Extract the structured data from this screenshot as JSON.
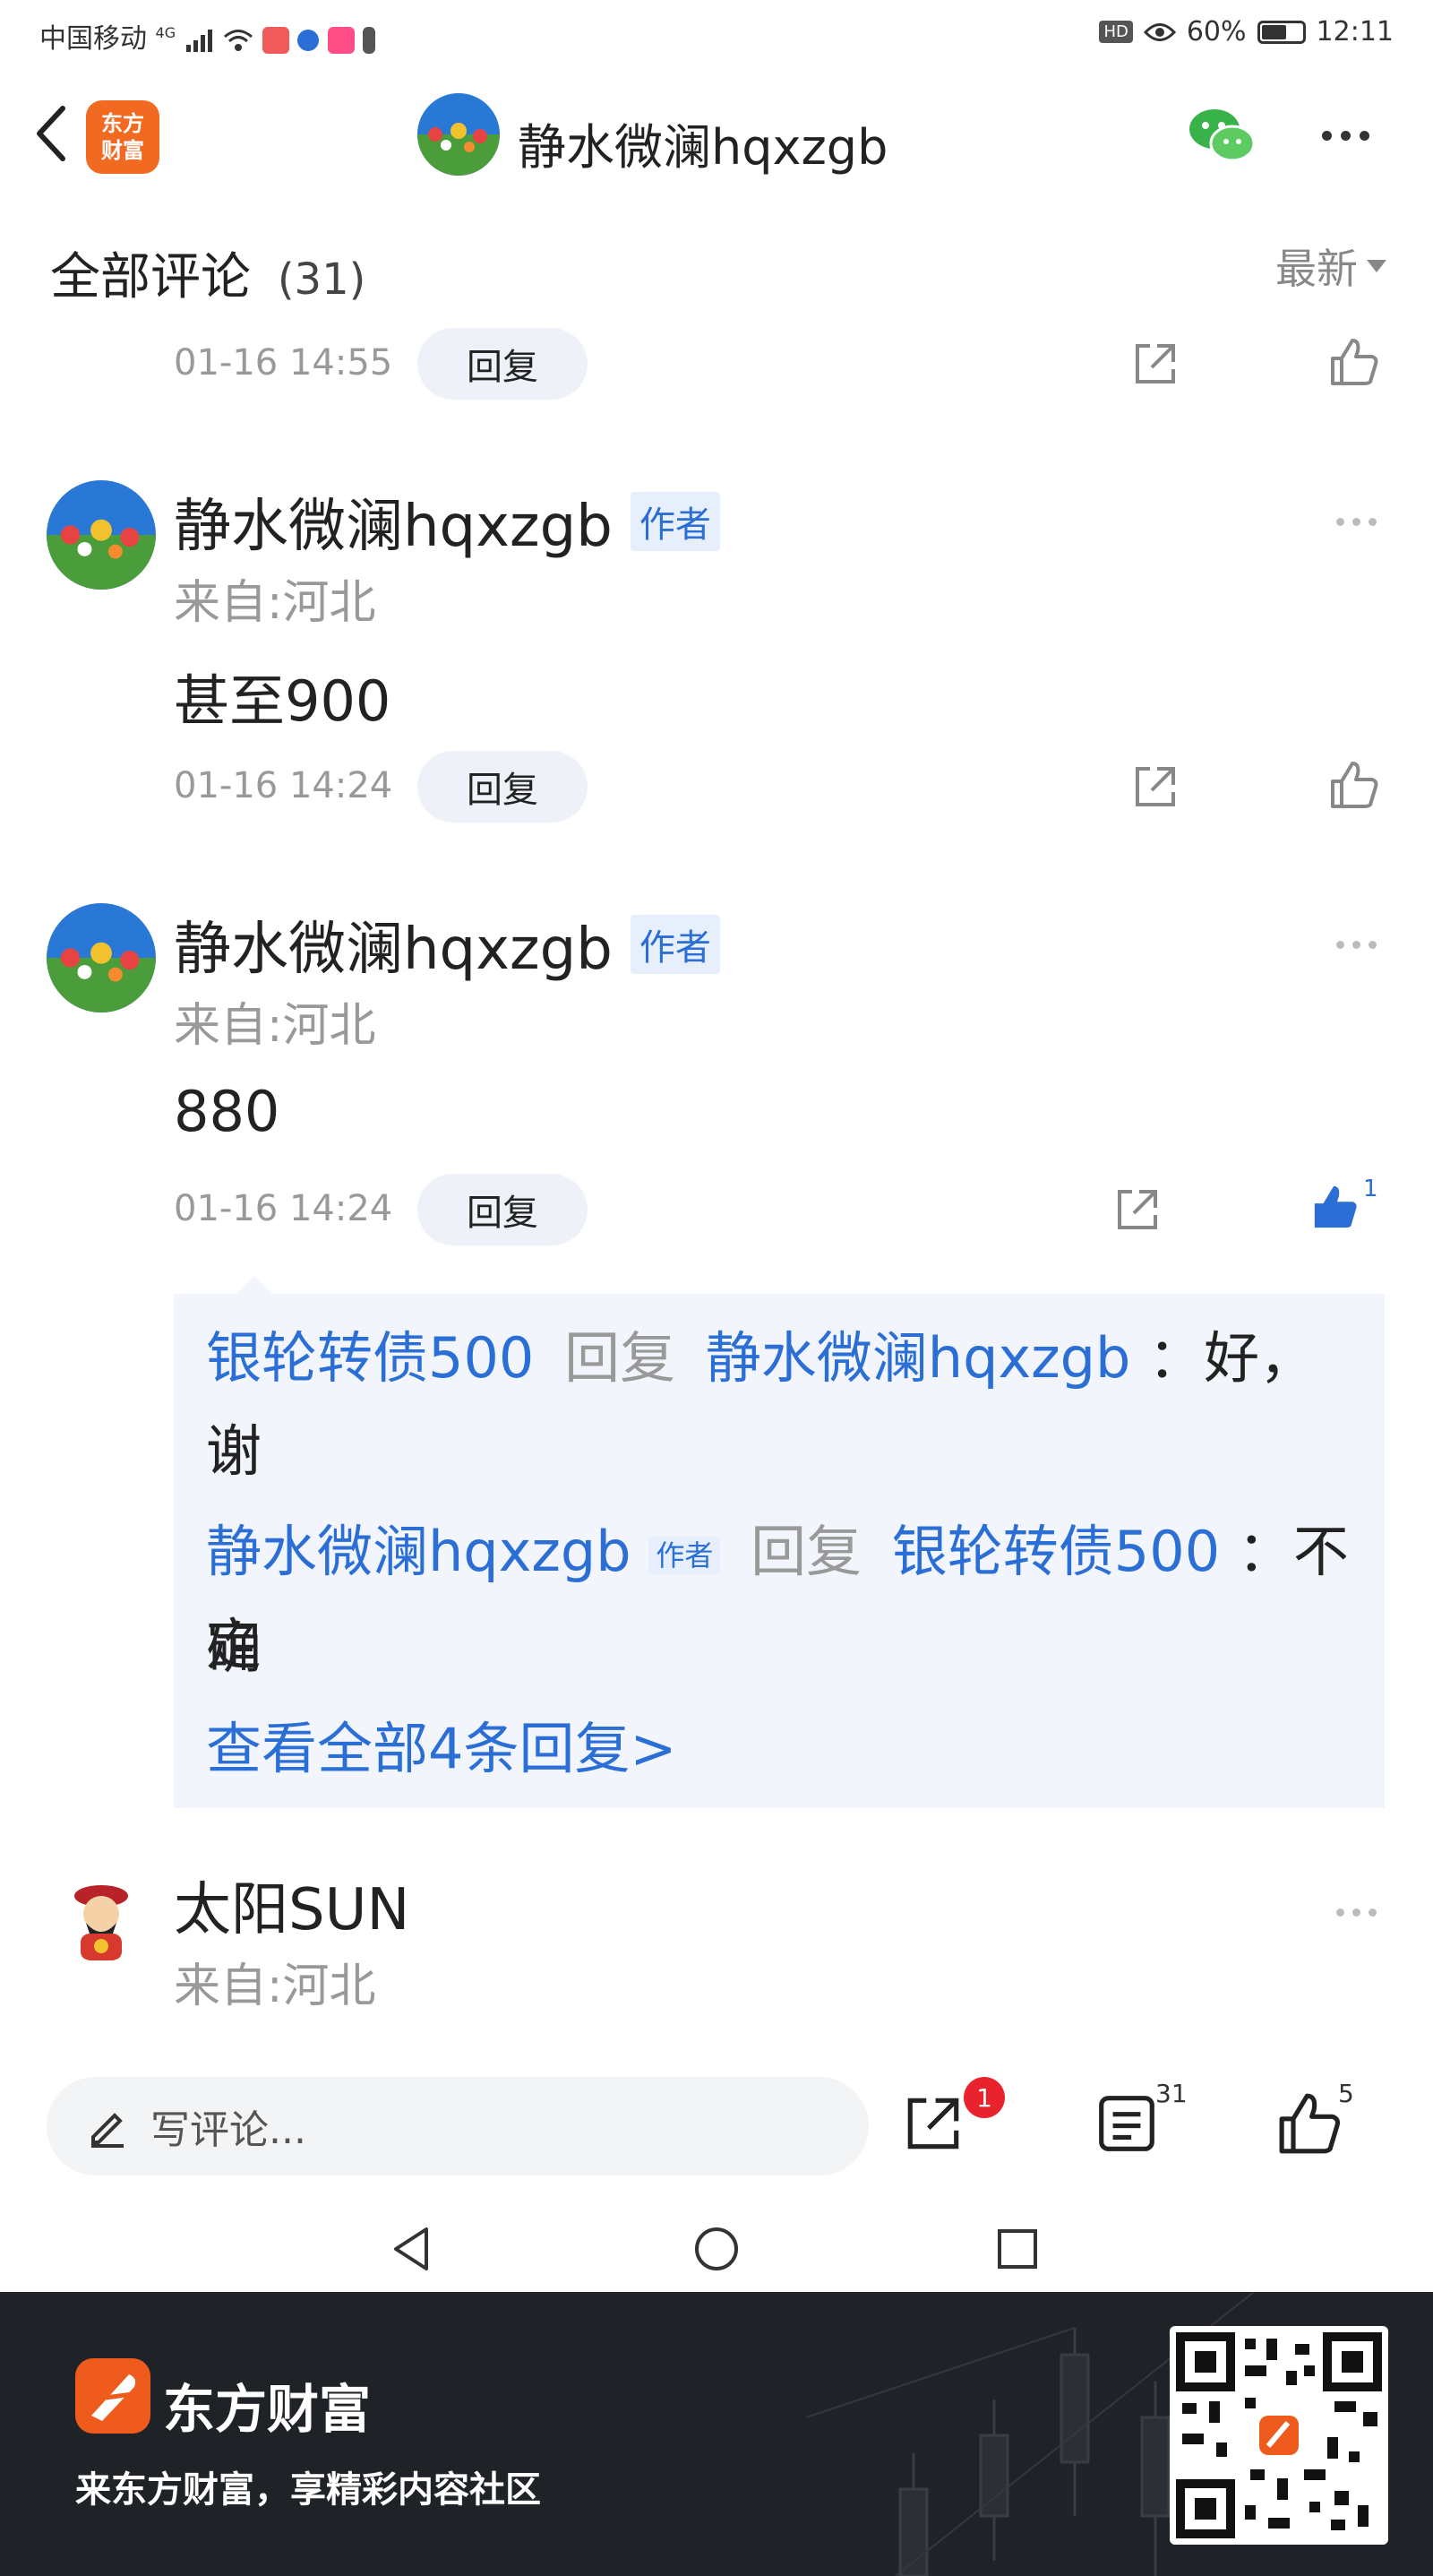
{
  "status_bar": {
    "carrier": "中国移动",
    "network": "4G",
    "battery_percent": "60%",
    "time": "12:11"
  },
  "header": {
    "app_logo_text": "东方财富",
    "title": "静水微澜hqxzgb"
  },
  "comments_header": {
    "title": "全部评论",
    "count": "(31)",
    "sort_label": "最新"
  },
  "comments": [
    {
      "time": "01-16 14:55",
      "reply_label": "回复"
    },
    {
      "author": "静水微澜hqxzgb",
      "author_tag": "作者",
      "from": "来自:河北",
      "text": "甚至900",
      "time": "01-16 14:24",
      "reply_label": "回复"
    },
    {
      "author": "静水微澜hqxzgb",
      "author_tag": "作者",
      "from": "来自:河北",
      "text": "880",
      "time": "01-16 14:24",
      "reply_label": "回复",
      "like_count": "1",
      "replies": [
        {
          "user": "银轮转债500",
          "reply_word": "回复",
          "target": "静水微澜hqxzgb",
          "text_line1": "：好，谢",
          "text_line2": "谢"
        },
        {
          "user": "静水微澜hqxzgb",
          "user_tag": "作者",
          "reply_word": "回复",
          "target": "银轮转债500",
          "text_line1": "：不确",
          "text_line2": "定"
        }
      ],
      "view_all": "查看全部4条回复>"
    },
    {
      "author": "太阳SUN",
      "from": "来自:河北"
    }
  ],
  "bottom_bar": {
    "input_placeholder": "写评论...",
    "share_badge": "1",
    "comment_count": "31",
    "like_count": "5"
  },
  "footer_ad": {
    "brand": "东方财富",
    "slogan": "来东方财富，享精彩内容社区"
  },
  "colors": {
    "accent_blue": "#2b6fd6",
    "brand_orange": "#f26a21",
    "badge_red": "#e8232d"
  }
}
